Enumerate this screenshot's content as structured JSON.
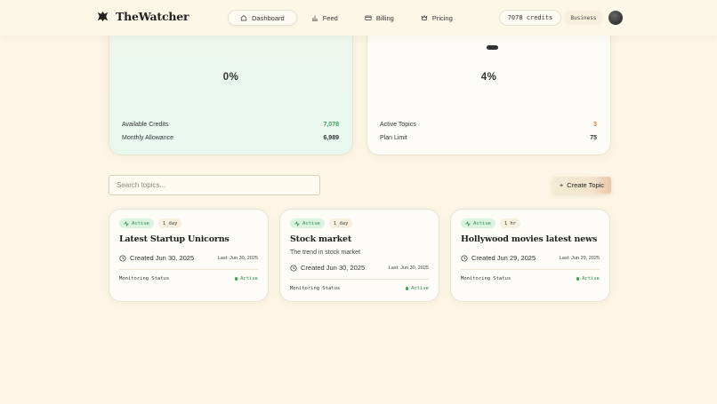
{
  "app": {
    "name": "TheWatcher"
  },
  "nav": {
    "items": [
      {
        "label": "Dashboard",
        "icon": "home-icon",
        "active": true
      },
      {
        "label": "Feed",
        "icon": "bar-chart-icon",
        "active": false
      },
      {
        "label": "Billing",
        "icon": "credit-card-icon",
        "active": false
      },
      {
        "label": "Pricing",
        "icon": "crown-icon",
        "active": false
      }
    ]
  },
  "account": {
    "credits": "7078 credits",
    "plan": "Business"
  },
  "stats": {
    "credits": {
      "percent": "0%",
      "rows": [
        {
          "label": "Available Credits",
          "value": "7,078",
          "color": "#3ba55c"
        },
        {
          "label": "Monthly Allowance",
          "value": "6,989",
          "color": "#333333"
        }
      ]
    },
    "topics": {
      "percent": "4%",
      "rows": [
        {
          "label": "Active Topics",
          "value": "3",
          "color": "#e07b39"
        },
        {
          "label": "Plan Limit",
          "value": "75",
          "color": "#333333"
        }
      ]
    }
  },
  "search": {
    "placeholder": "Search topics..."
  },
  "create_button": {
    "label": "Create Topic"
  },
  "topics": [
    {
      "status": "Active",
      "duration": "1 day",
      "title": "Latest Startup Unicorns",
      "description": "",
      "created": "Created Jun 30, 2025",
      "last": "Last: Jun 30, 2025",
      "monitoring_label": "Monitoring Status",
      "monitoring_value": "Active"
    },
    {
      "status": "Active",
      "duration": "1 day",
      "title": "Stock market",
      "description": "The trend in stock market",
      "created": "Created Jun 30, 2025",
      "last": "Last: Jun 30, 2025",
      "monitoring_label": "Monitoring Status",
      "monitoring_value": "Active"
    },
    {
      "status": "Active",
      "duration": "1 hr",
      "title": "Hollywood movies latest news",
      "description": "",
      "created": "Created Jun 29, 2025",
      "last": "Last: Jun 29, 2025",
      "monitoring_label": "Monitoring Status",
      "monitoring_value": "Active"
    }
  ]
}
